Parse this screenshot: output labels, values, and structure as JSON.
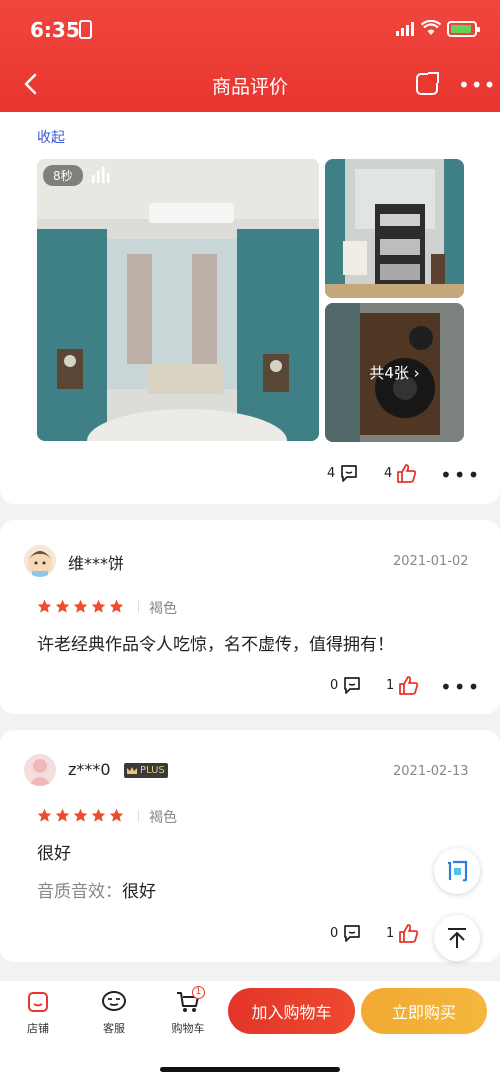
{
  "status_bar": {
    "time": "6:35"
  },
  "nav": {
    "title": "商品评价"
  },
  "review_expanded": {
    "collapse_label": "收起",
    "video_duration": "8秒",
    "more_photos_label": "共4张",
    "comment_count": "4",
    "like_count": "4"
  },
  "reviews": [
    {
      "username": "维***饼",
      "date": "2021-01-02",
      "spec": "褐色",
      "content": "许老经典作品令人吃惊，名不虚传，值得拥有！",
      "comment_count": "0",
      "like_count": "1"
    },
    {
      "username": "z***0",
      "badge": "PLUS",
      "date": "2021-02-13",
      "spec": "褐色",
      "content": "很好",
      "quality_label": "音质音效：",
      "quality_value": "很好",
      "comment_count": "0",
      "like_count": "1"
    }
  ],
  "tabbar": {
    "store": "店铺",
    "service": "客服",
    "cart": "购物车",
    "cart_badge": "1",
    "add_to_cart": "加入购物车",
    "buy_now": "立即购买"
  },
  "colors": {
    "brand_red": "#e8352f",
    "star": "#f04b2a",
    "buy": "#f2a933",
    "link": "#3b5bdb"
  },
  "icons": [
    "back-icon",
    "share-icon",
    "more-icon",
    "comment-icon",
    "thumbs-up-icon",
    "star-icon",
    "store-icon",
    "service-icon",
    "cart-icon",
    "ask-icon",
    "scroll-top-icon"
  ]
}
